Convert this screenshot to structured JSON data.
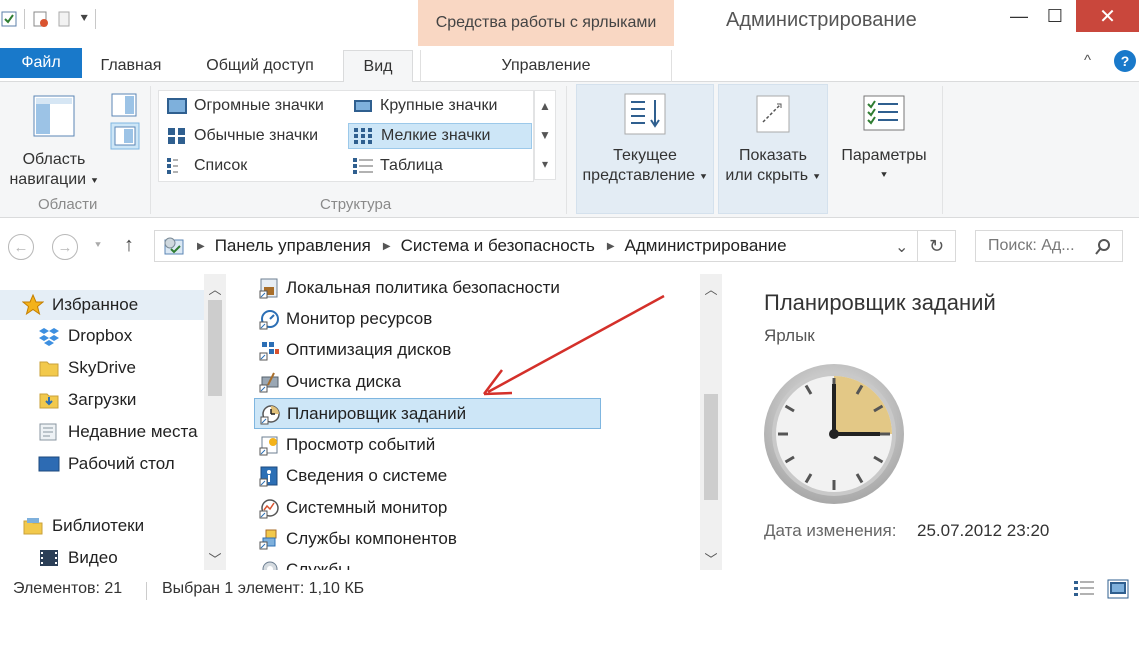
{
  "titlebar": {
    "context_tab_title": "Средства работы с ярлыками",
    "window_title": "Администрирование",
    "minimize_glyph": "—",
    "maximize_glyph": "☐",
    "close_glyph": "✕"
  },
  "tabs": {
    "file": "Файл",
    "home": "Главная",
    "share": "Общий доступ",
    "view": "Вид",
    "manage": "Управление"
  },
  "ribbon": {
    "nav_pane_line1": "Область",
    "nav_pane_line2": "навигации",
    "group_areas": "Области",
    "layout_items": {
      "extra_large": "Огромные значки",
      "large": "Крупные значки",
      "medium": "Обычные значки",
      "small": "Мелкие значки",
      "list": "Список",
      "details": "Таблица"
    },
    "selected_layout": "small",
    "group_layout": "Структура",
    "current_view_line1": "Текущее",
    "current_view_line2": "представление",
    "show_hide_line1": "Показать",
    "show_hide_line2": "или скрыть",
    "options": "Параметры",
    "help_glyph": "?",
    "collapse_glyph": "^"
  },
  "address": {
    "crumbs": [
      "Панель управления",
      "Система и безопасность",
      "Администрирование"
    ],
    "search_placeholder": "Поиск: Ад..."
  },
  "navpane": {
    "favorites": "Избранное",
    "dropbox": "Dropbox",
    "skydrive": "SkyDrive",
    "downloads": "Загрузки",
    "recent": "Недавние места",
    "desktop": "Рабочий стол",
    "libraries": "Библиотеки",
    "video": "Видео"
  },
  "files": [
    "Локальная политика безопасности",
    "Монитор ресурсов",
    "Оптимизация дисков",
    "Очистка диска",
    "Планировщик заданий",
    "Просмотр событий",
    "Сведения о системе",
    "Системный монитор",
    "Службы компонентов",
    "Службы"
  ],
  "selected_file_index": 4,
  "preview": {
    "title": "Планировщик заданий",
    "type": "Ярлык",
    "date_label": "Дата изменения:",
    "date_value": "25.07.2012 23:20"
  },
  "status": {
    "count": "Элементов: 21",
    "selected": "Выбран 1 элемент: 1,10 КБ"
  },
  "colors": {
    "accent": "#1979ca",
    "context_tab": "#f9d7c3",
    "close_button": "#c9473c",
    "selection": "#cde6f7",
    "annotation_arrow": "#d4302a"
  }
}
